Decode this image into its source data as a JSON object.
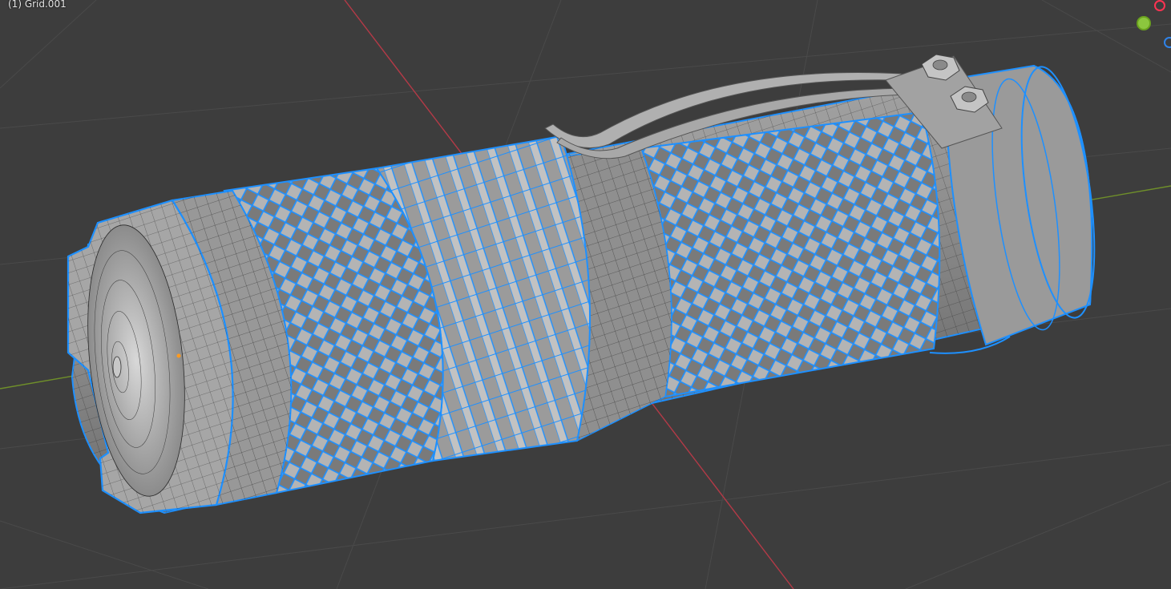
{
  "viewport": {
    "object_label": "(1) Grid.001"
  },
  "colors": {
    "background": "#3d3d3d",
    "grid_line": "#484848",
    "x_axis": "#b43a47",
    "y_axis": "#6f8f2a",
    "mesh_fill": "#8e8e8e",
    "mesh_wire": "#222222",
    "selection": "#1e90ff"
  },
  "gizmo": {
    "x_color": "#ff3352",
    "y_color": "#8cc63e",
    "z_color": "#2f83e8"
  }
}
